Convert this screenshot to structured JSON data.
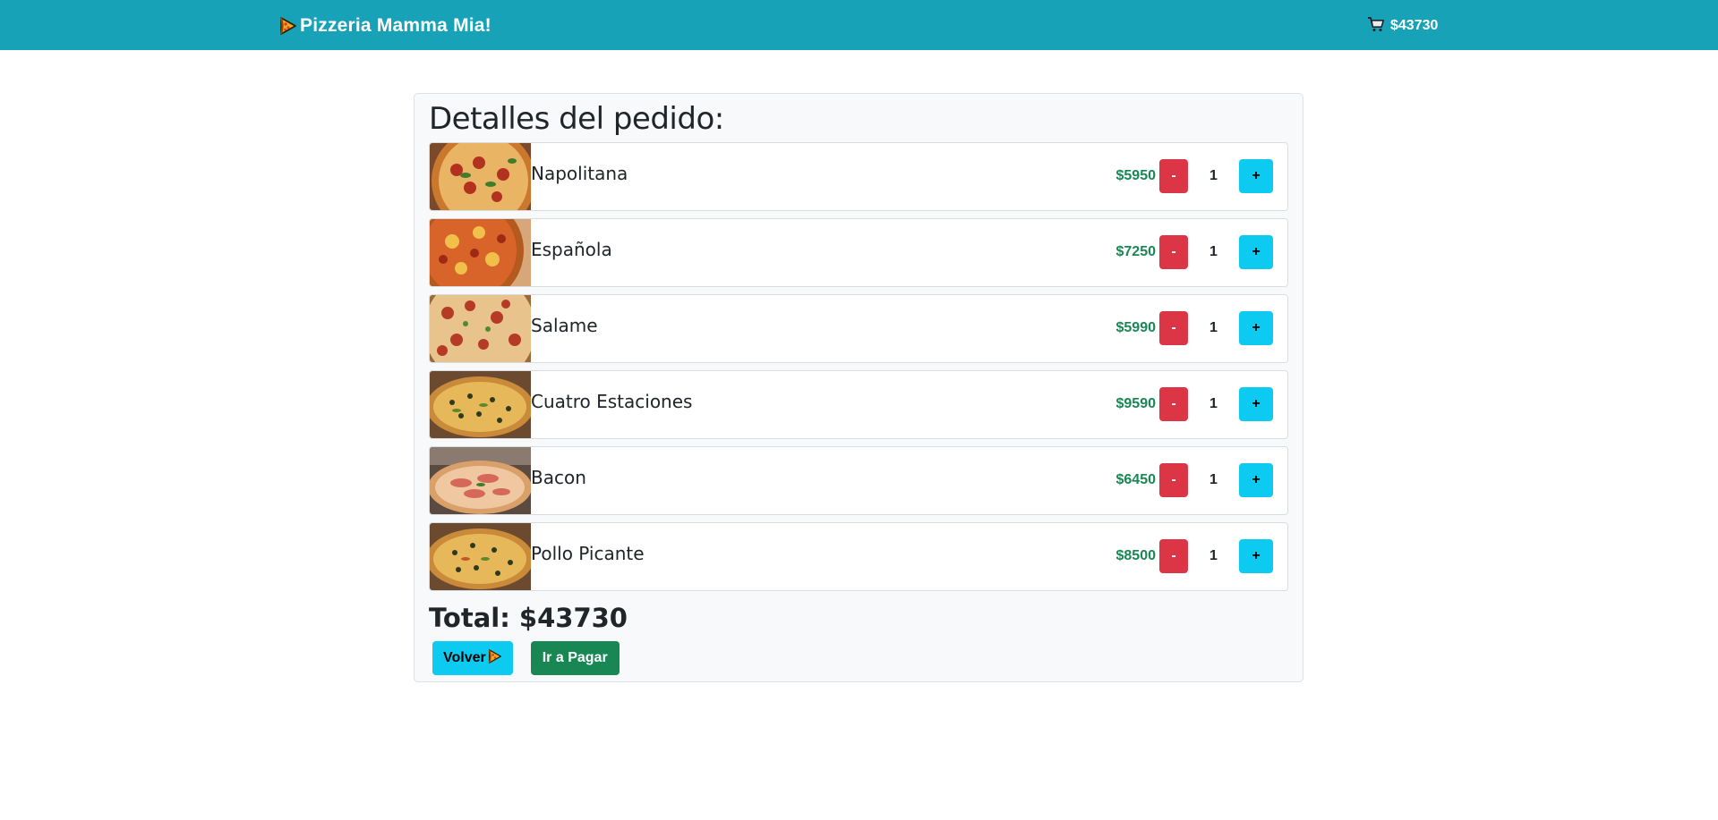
{
  "navbar": {
    "brand": "Pizzeria Mamma Mia!",
    "cart_total": "$43730",
    "bg_color": "#17a2b8"
  },
  "order": {
    "title": "Detalles del pedido:",
    "items": [
      {
        "name": "Napolitana",
        "price": "$5950",
        "qty": "1",
        "minus": "-",
        "plus": "+",
        "image": "napolitana"
      },
      {
        "name": "Española",
        "price": "$7250",
        "qty": "1",
        "minus": "-",
        "plus": "+",
        "image": "espanola"
      },
      {
        "name": "Salame",
        "price": "$5990",
        "qty": "1",
        "minus": "-",
        "plus": "+",
        "image": "salame"
      },
      {
        "name": "Cuatro Estaciones",
        "price": "$9590",
        "qty": "1",
        "minus": "-",
        "plus": "+",
        "image": "cuatro-estaciones"
      },
      {
        "name": "Bacon",
        "price": "$6450",
        "qty": "1",
        "minus": "-",
        "plus": "+",
        "image": "bacon"
      },
      {
        "name": "Pollo Picante",
        "price": "$8500",
        "qty": "1",
        "minus": "-",
        "plus": "+",
        "image": "pollo-picante"
      }
    ],
    "total": "Total: $43730",
    "back_label": "Volver",
    "pay_label": "Ir a Pagar"
  },
  "icons": {
    "brand_icon": "pizza-slice-icon",
    "cart_icon": "shopping-cart-icon",
    "back_icon": "pizza-slice-icon"
  },
  "colors": {
    "price": "#198754",
    "minus_button": "#dc3545",
    "plus_button": "#0dcaf0",
    "pay_button": "#198754"
  }
}
